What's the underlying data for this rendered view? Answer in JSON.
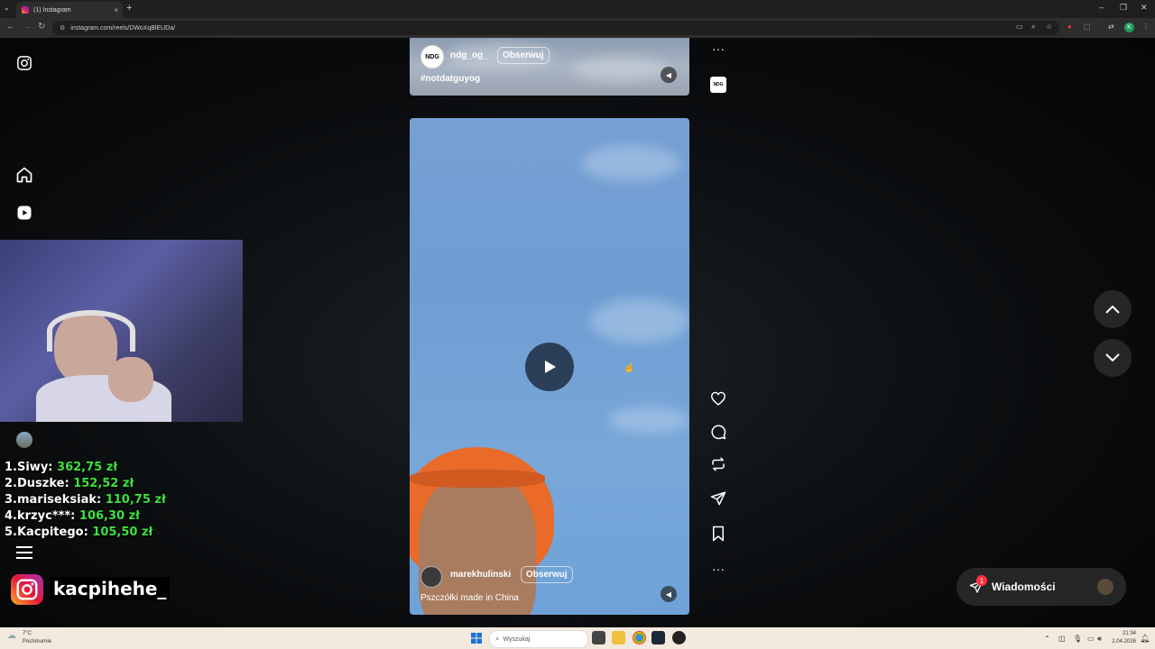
{
  "browser": {
    "tab_title": "(1) Instagram",
    "tab_close": "×",
    "new_tab": "+",
    "url": "instagram.com/reels/DWoXqBlEUDa/",
    "profile_initial": "K",
    "window_controls": [
      "–",
      "❐",
      "✕"
    ]
  },
  "reels": [
    {
      "username": "ndg_og_",
      "avatar_text": "NDG",
      "follow_label": "Obserwuj",
      "caption": "#notdatguyog"
    },
    {
      "username": "marekhulinski",
      "follow_label": "Obserwuj",
      "caption": "Pszczółki made in China"
    }
  ],
  "actions": {
    "more_top": "···",
    "more_bottom": "···",
    "audio_thumb_text": "NDG"
  },
  "messages": {
    "label": "Wiadomości",
    "badge": "1"
  },
  "overlay": {
    "leaderboard": [
      {
        "rank": "1.",
        "name": "Siwy:",
        "amount": "362,75 zł"
      },
      {
        "rank": "2.",
        "name": "Duszke:",
        "amount": "152,52 zł"
      },
      {
        "rank": "3.",
        "name": "mariseksiak:",
        "amount": "110,75 zł"
      },
      {
        "rank": "4.",
        "name": "krzyc***:",
        "amount": "106,30 zł"
      },
      {
        "rank": "5.",
        "name": "Kacpitego:",
        "amount": "105,50 zł"
      }
    ],
    "handle": "kacpihehe_"
  },
  "taskbar": {
    "weather_temp": "7°C",
    "weather_desc": "Pochmurnie",
    "search_placeholder": "Wyszukaj",
    "time": "21:34",
    "date": "2.04.2026"
  }
}
